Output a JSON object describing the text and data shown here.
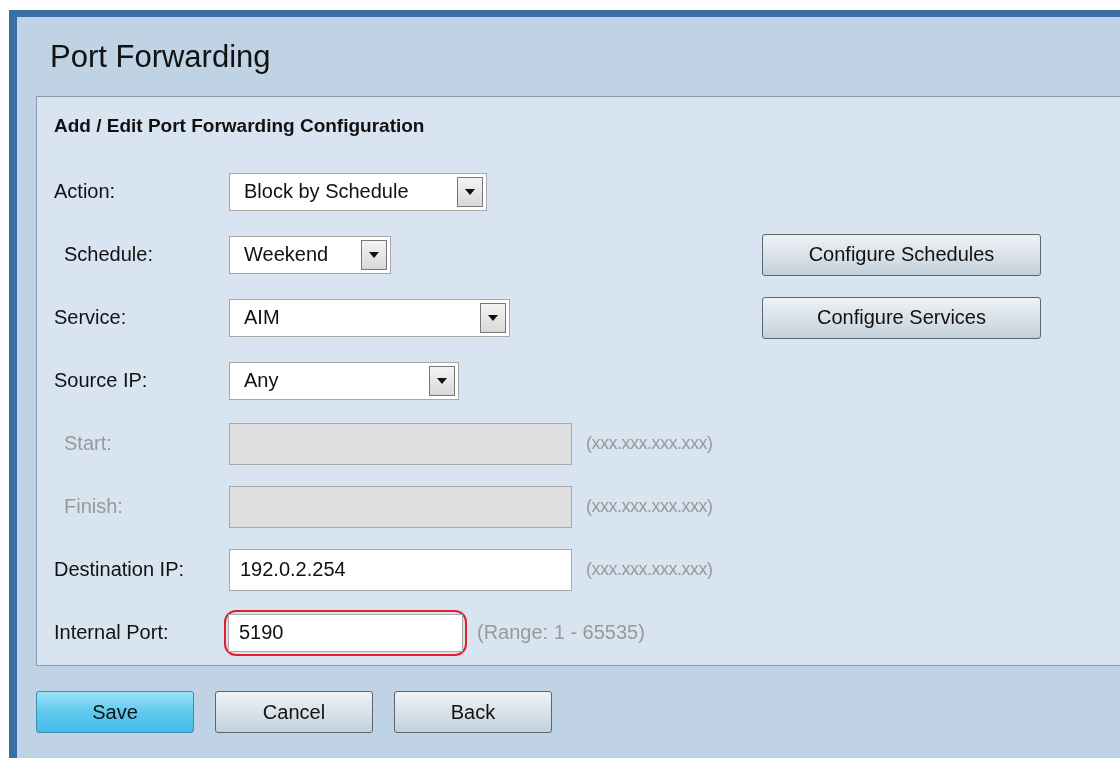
{
  "page": {
    "title": "Port Forwarding"
  },
  "panel": {
    "title": "Add / Edit Port Forwarding Configuration",
    "rows": [
      {
        "kind": "select",
        "label": "Action:",
        "indented": false,
        "value": "Block by Schedule",
        "disabled": false
      },
      {
        "kind": "select",
        "label": "Schedule:",
        "indented": true,
        "value": "Weekend",
        "disabled": false,
        "side_button": "Configure Schedules"
      },
      {
        "kind": "select",
        "label": "Service:",
        "indented": false,
        "value": "AIM",
        "disabled": false,
        "side_button": "Configure Services"
      },
      {
        "kind": "select",
        "label": "Source IP:",
        "indented": false,
        "value": "Any",
        "disabled": false
      },
      {
        "kind": "input",
        "label": "Start:",
        "indented": true,
        "disabled": true,
        "hint": "(xxx.xxx.xxx.xxx)"
      },
      {
        "kind": "input",
        "label": "Finish:",
        "indented": true,
        "disabled": true,
        "hint": "(xxx.xxx.xxx.xxx)"
      },
      {
        "kind": "input",
        "label": "Destination IP:",
        "indented": false,
        "value": "192.0.2.254",
        "disabled": false,
        "hint": "(xxx.xxx.xxx.xxx)"
      },
      {
        "kind": "input",
        "label": "Internal Port:",
        "indented": false,
        "value": "5190",
        "disabled": false,
        "highlighted": true,
        "hint": "(Range: 1 - 65535)"
      }
    ]
  },
  "buttons": [
    {
      "label": "Save",
      "primary": true
    },
    {
      "label": "Cancel",
      "primary": false
    },
    {
      "label": "Back",
      "primary": false
    }
  ]
}
